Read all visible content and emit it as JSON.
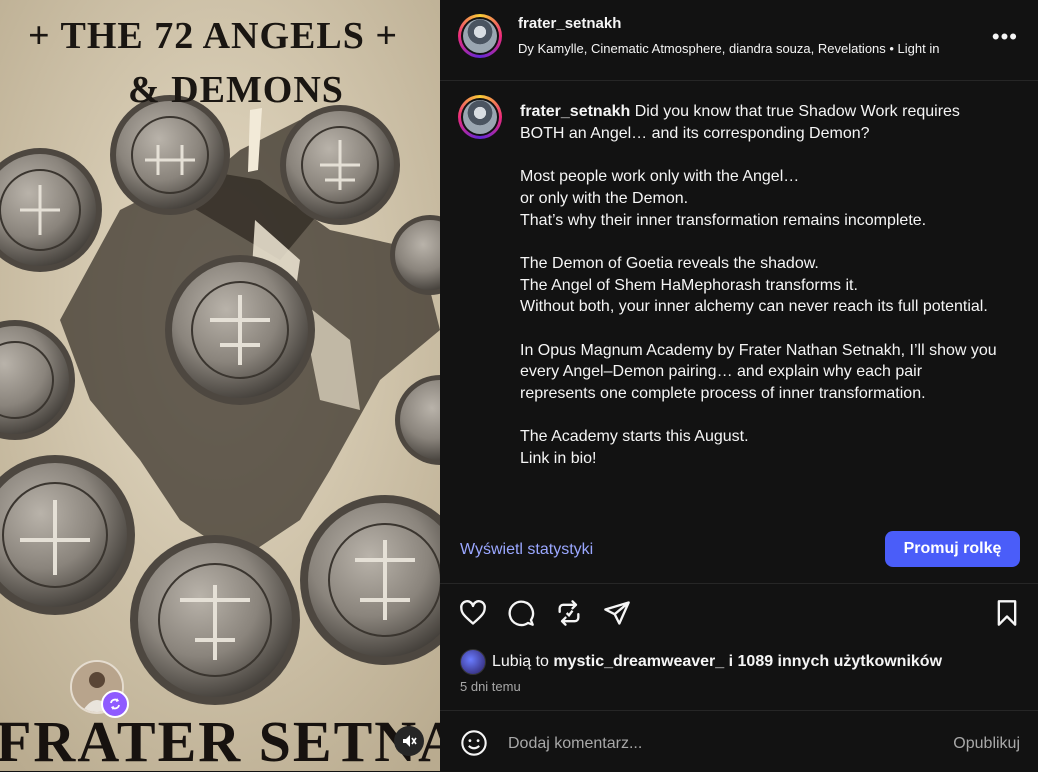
{
  "media": {
    "title_line1": "+ THE 72 ANGELS +",
    "title_line2": "& DEMONS",
    "footer_text": "FRATER SETNAKH",
    "creator_avatar": "creator-avatar",
    "remix_icon": "remix-icon",
    "mute_icon": "muted-speaker-icon"
  },
  "header": {
    "username": "frater_setnakh",
    "audio": "Dy Kamylle, Cinematic Atmosphere, diandra souza, Revelations • Light in",
    "more_label": "•••"
  },
  "caption": {
    "username": "frater_setnakh",
    "lines": [
      "Did you know that true Shadow Work requires BOTH an Angel… and its corresponding Demon?",
      "",
      "Most people work only with the Angel…",
      "or only with the Demon.",
      "That’s why their inner transformation remains incomplete.",
      "",
      "The Demon of Goetia reveals the shadow.",
      "The Angel of Shem HaMephorash transforms it.",
      "Without both, your inner alchemy can never reach its full potential.",
      "",
      "In Opus Magnum Academy by Frater Nathan Setnakh, I’ll show you every Angel–Demon pairing… and explain why each pair represents one complete process of inner transformation.",
      "",
      "The Academy starts this August.",
      "Link in bio!"
    ]
  },
  "stats": {
    "view_insights": "Wyświetl statystyki",
    "promote": "Promuj rolkę"
  },
  "actions": {
    "like_icon": "heart-icon",
    "comment_icon": "comment-icon",
    "repost_icon": "repost-icon",
    "share_icon": "send-icon",
    "save_icon": "bookmark-icon"
  },
  "likes": {
    "prefix": "Lubią to",
    "user": "mystic_dreamweaver_",
    "suffix": "i 1089 innych użytkowników"
  },
  "timestamp": "5 dni temu",
  "comment": {
    "placeholder": "Dodaj komentarz...",
    "post": "Opublikuj",
    "emoji_icon": "emoji-icon"
  },
  "colors": {
    "background": "#121212",
    "accent": "#4a5df9",
    "link": "#9aa7ff",
    "muted": "#a8a8a8"
  }
}
